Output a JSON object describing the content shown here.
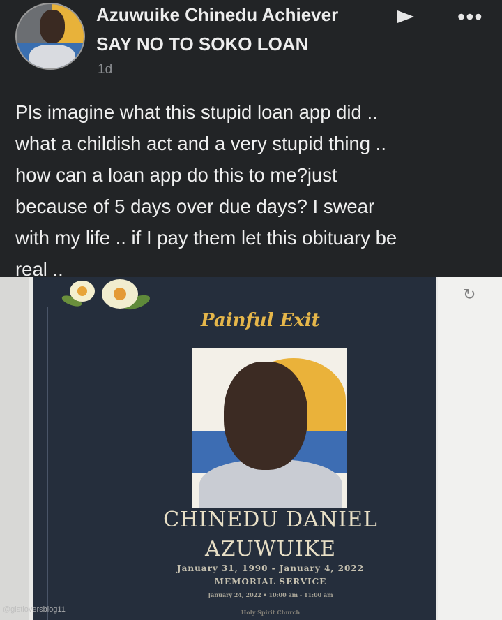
{
  "post": {
    "author": "Azuwuike Chinedu Achiever",
    "group": "SAY NO TO SOKO LOAN",
    "time": "1d",
    "more_icon": "•••",
    "text_lines": [
      "Pls imagine what this stupid loan app did ..",
      "what a childish act and a very stupid thing ..",
      "how can a loan app do this to me?just",
      "because of 5 days over due days? I swear",
      "with my life .. if I pay them let this obituary be",
      "real .."
    ]
  },
  "obituary": {
    "headline": "Painful Exit",
    "name_line1": "CHINEDU DANIEL",
    "name_line2": "AZUWUIKE",
    "dates": "January 31, 1990 - January 4, 2022",
    "memorial": "MEMORIAL SERVICE",
    "service_time": "January 24, 2022 • 10:00 am - 11:00 am",
    "church": "Holy Spirit Church"
  },
  "watermark": "@gistloversblog11",
  "icons": {
    "arrow": "right-triangle-icon",
    "more": "more-options-icon",
    "refresh": "refresh-icon"
  }
}
